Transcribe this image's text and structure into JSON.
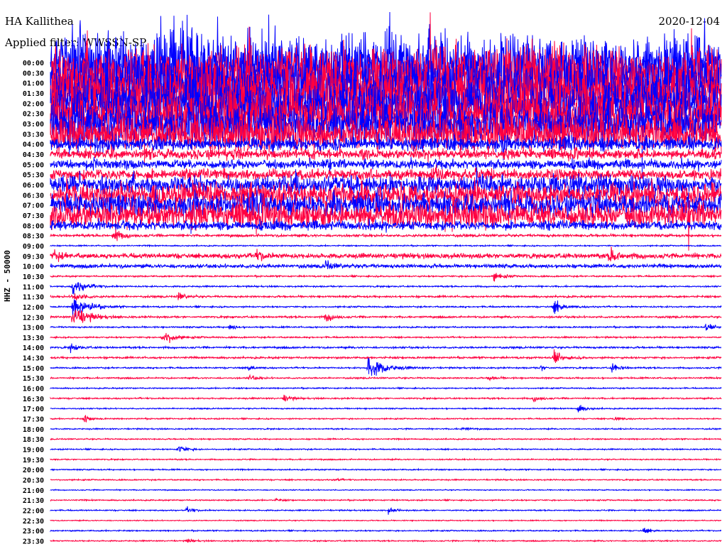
{
  "header": {
    "station": "HA Kallithea",
    "filter": "Applied filter: WWSSN-SP",
    "date": "2020-12-04"
  },
  "chart_data": {
    "type": "line",
    "title": "HA Kallithea",
    "ylabel": "HHZ - 50000",
    "minutes_per_row": 30,
    "colors": [
      "#0000ff",
      "#ff0040"
    ],
    "rows": [
      "00:00",
      "00:30",
      "01:00",
      "01:30",
      "02:00",
      "02:30",
      "03:00",
      "03:30",
      "04:00",
      "04:30",
      "05:00",
      "05:30",
      "06:00",
      "06:30",
      "07:00",
      "07:30",
      "08:00",
      "08:30",
      "09:00",
      "09:30",
      "10:00",
      "10:30",
      "11:00",
      "11:30",
      "12:00",
      "12:30",
      "13:00",
      "13:30",
      "14:00",
      "14:30",
      "15:00",
      "15:30",
      "16:00",
      "16:30",
      "17:00",
      "17:30",
      "18:00",
      "18:30",
      "19:00",
      "19:30",
      "20:00",
      "20:30",
      "21:00",
      "21:30",
      "22:00",
      "22:30",
      "23:00",
      "23:30"
    ],
    "noise_level": [
      38,
      36,
      36,
      34,
      34,
      32,
      30,
      22,
      8,
      6,
      6,
      7,
      12,
      14,
      14,
      16,
      6,
      2,
      1,
      4,
      3,
      1.2,
      1.2,
      1.5,
      1.2,
      1.5,
      1.2,
      1.2,
      1.5,
      1.5,
      1.2,
      1.2,
      1,
      1.2,
      1,
      1,
      1,
      1,
      1,
      1,
      1,
      1,
      0.8,
      1,
      1,
      0.8,
      1,
      1
    ],
    "events": [
      {
        "row": 17,
        "minute": 2.8,
        "amp": 10
      },
      {
        "row": 19,
        "minute": 0.1,
        "amp": 8
      },
      {
        "row": 19,
        "minute": 9.2,
        "amp": 8
      },
      {
        "row": 19,
        "minute": 25,
        "amp": 12
      },
      {
        "row": 20,
        "minute": 12.3,
        "amp": 8
      },
      {
        "row": 21,
        "minute": 19.8,
        "amp": 8
      },
      {
        "row": 22,
        "minute": 1.0,
        "amp": 15
      },
      {
        "row": 23,
        "minute": 1.0,
        "amp": 10
      },
      {
        "row": 23,
        "minute": 5.7,
        "amp": 7
      },
      {
        "row": 24,
        "minute": 1.0,
        "amp": 20
      },
      {
        "row": 24,
        "minute": 22.5,
        "amp": 12
      },
      {
        "row": 25,
        "minute": 1.0,
        "amp": 20
      },
      {
        "row": 25,
        "minute": 12.3,
        "amp": 8
      },
      {
        "row": 26,
        "minute": 8.0,
        "amp": 5
      },
      {
        "row": 26,
        "minute": 29.3,
        "amp": 6
      },
      {
        "row": 27,
        "minute": 5.0,
        "amp": 14
      },
      {
        "row": 28,
        "minute": 0.9,
        "amp": 7
      },
      {
        "row": 29,
        "minute": 22.5,
        "amp": 10
      },
      {
        "row": 30,
        "minute": 8.8,
        "amp": 6
      },
      {
        "row": 30,
        "minute": 14.2,
        "amp": 22
      },
      {
        "row": 30,
        "minute": 21.9,
        "amp": 5
      },
      {
        "row": 30,
        "minute": 25.1,
        "amp": 8
      },
      {
        "row": 31,
        "minute": 8.9,
        "amp": 5
      },
      {
        "row": 31,
        "minute": 19.6,
        "amp": 5
      },
      {
        "row": 33,
        "minute": 10.4,
        "amp": 6
      },
      {
        "row": 33,
        "minute": 21.6,
        "amp": 6
      },
      {
        "row": 34,
        "minute": 23.6,
        "amp": 7
      },
      {
        "row": 35,
        "minute": 1.5,
        "amp": 6
      },
      {
        "row": 35,
        "minute": 25.2,
        "amp": 5
      },
      {
        "row": 36,
        "minute": 18.4,
        "amp": 4
      },
      {
        "row": 38,
        "minute": 5.7,
        "amp": 8
      },
      {
        "row": 41,
        "minute": 12.7,
        "amp": 3
      },
      {
        "row": 43,
        "minute": 10.1,
        "amp": 3
      },
      {
        "row": 44,
        "minute": 6.1,
        "amp": 5
      },
      {
        "row": 44,
        "minute": 15.1,
        "amp": 5
      },
      {
        "row": 46,
        "minute": 26.5,
        "amp": 6
      },
      {
        "row": 47,
        "minute": 6.1,
        "amp": 4
      }
    ]
  }
}
